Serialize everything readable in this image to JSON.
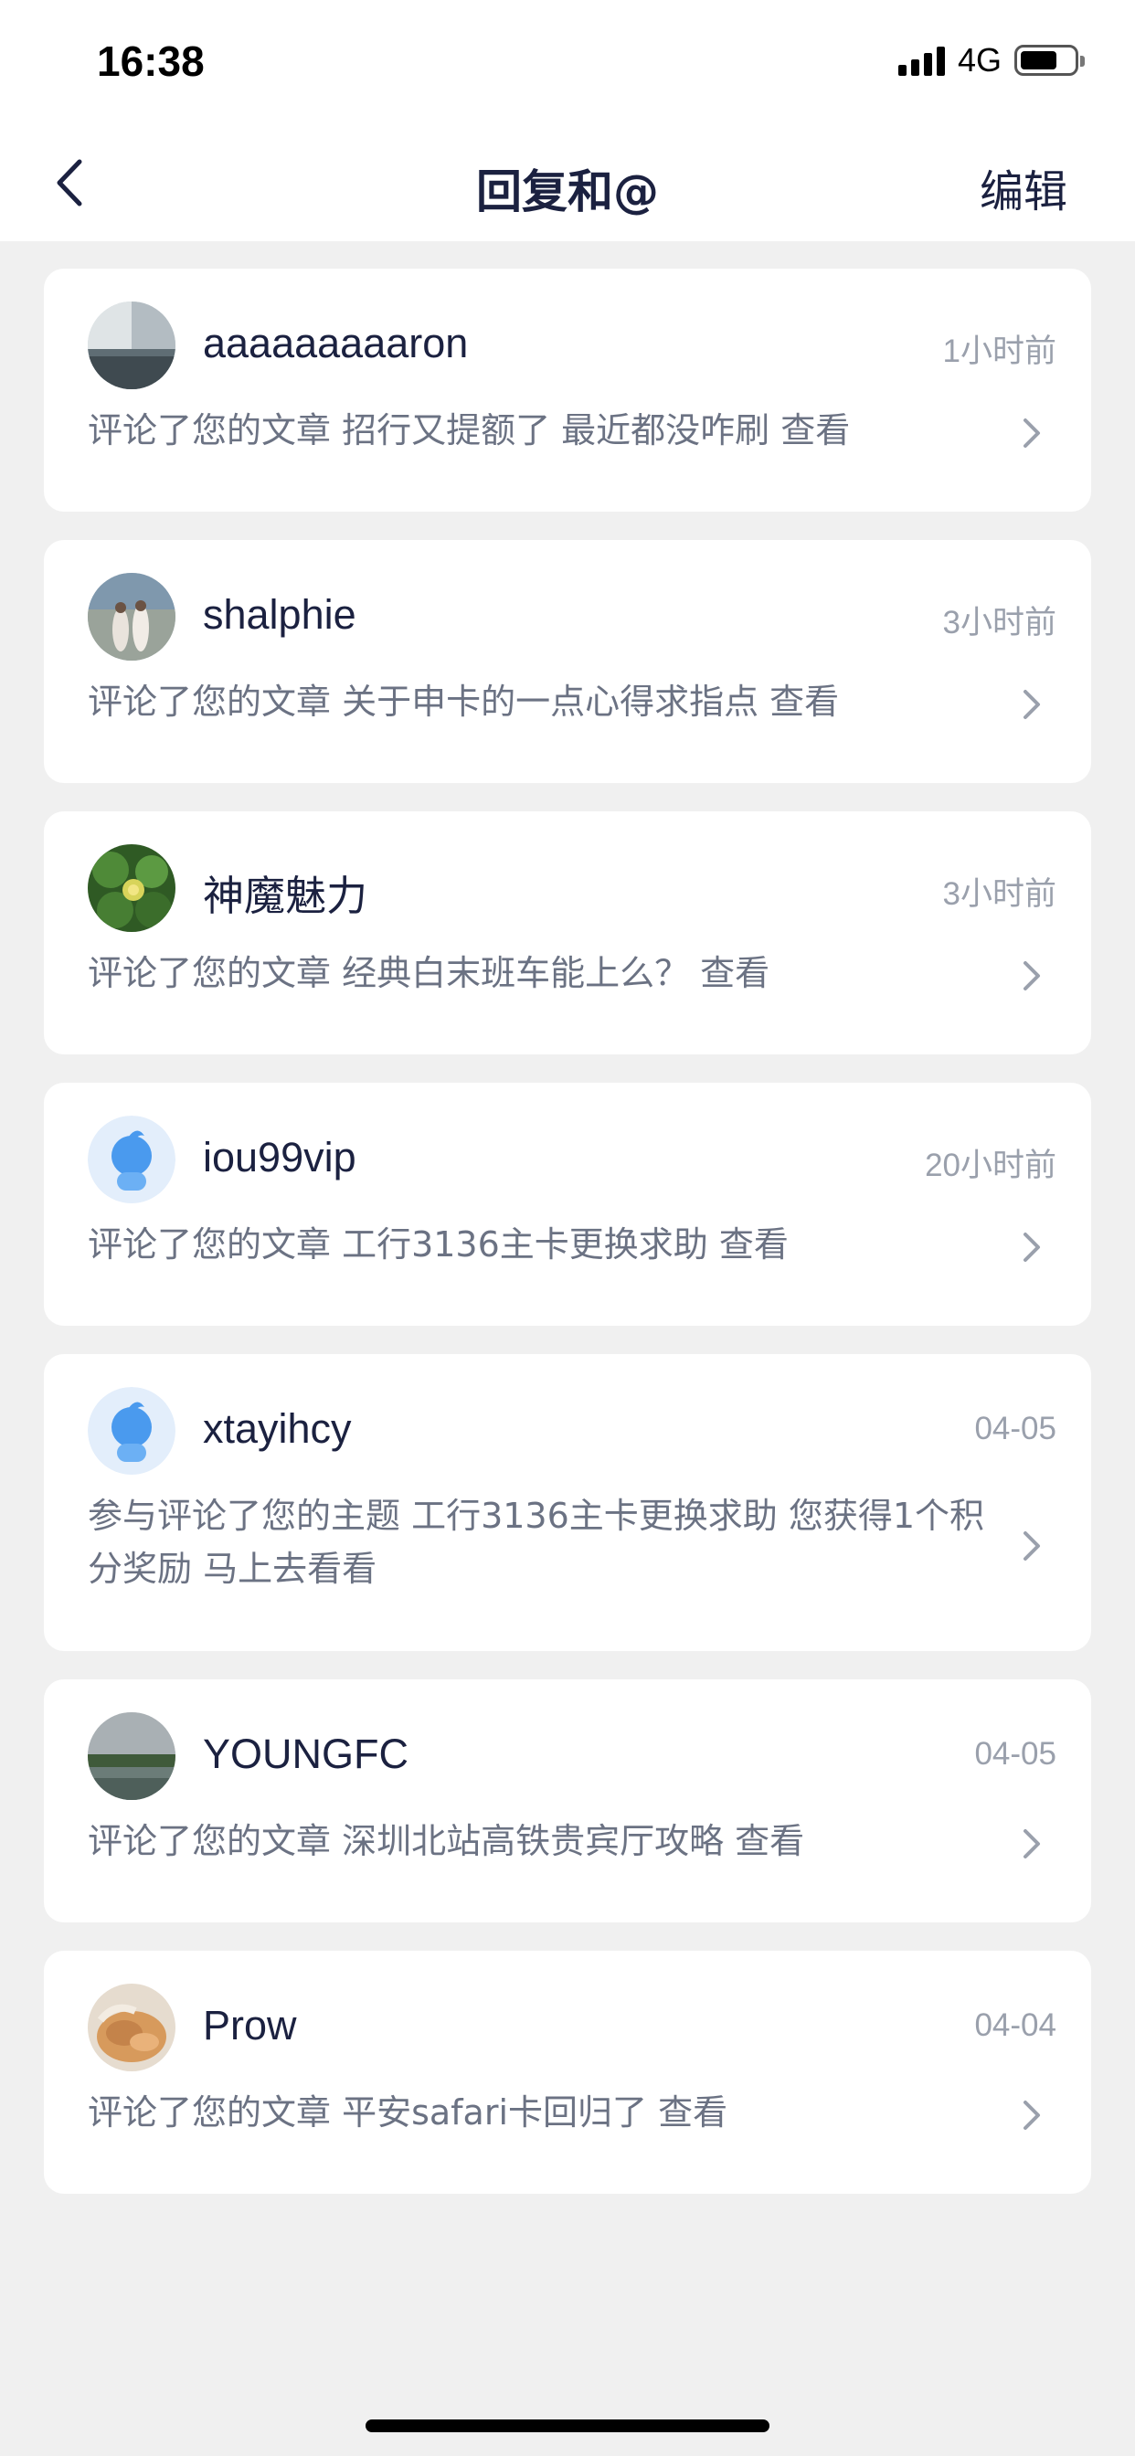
{
  "status_bar": {
    "time": "16:38",
    "network": "4G",
    "icons": [
      "signal-icon",
      "battery-icon"
    ]
  },
  "nav": {
    "title": "回复和@",
    "edit_label": "编辑",
    "back_icon": "chevron-left-icon"
  },
  "notifications": [
    {
      "username": "aaaaaaaaaron",
      "time": "1小时前",
      "text": "评论了您的文章 招行又提额了 最近都没咋刷 查看",
      "avatar": "sea-photo"
    },
    {
      "username": "shalphie",
      "time": "3小时前",
      "text": "评论了您的文章 关于申卡的一点心得求指点 查看",
      "avatar": "people-photo"
    },
    {
      "username": "神魔魅力",
      "time": "3小时前",
      "text": "评论了您的文章 经典白末班车能上么？ 查看",
      "avatar": "plant-photo"
    },
    {
      "username": "iou99vip",
      "time": "20小时前",
      "text": "评论了您的文章 工行3136主卡更换求助 查看",
      "avatar": "default-avatar"
    },
    {
      "username": "xtayihcy",
      "time": "04-05",
      "text": "参与评论了您的主题 工行3136主卡更换求助 您获得1个积分奖励 马上去看看",
      "avatar": "default-avatar"
    },
    {
      "username": "YOUNGFC",
      "time": "04-05",
      "text": "评论了您的文章 深圳北站高铁贵宾厅攻略 查看",
      "avatar": "lake-photo"
    },
    {
      "username": "Prow",
      "time": "04-04",
      "text": "评论了您的文章 平安safari卡回归了 查看",
      "avatar": "cat-photo"
    }
  ],
  "colors": {
    "background": "#f0f0f0",
    "card": "#ffffff",
    "title": "#1b2140",
    "body_text": "#6b7283",
    "time_text": "#9aa0ac"
  }
}
